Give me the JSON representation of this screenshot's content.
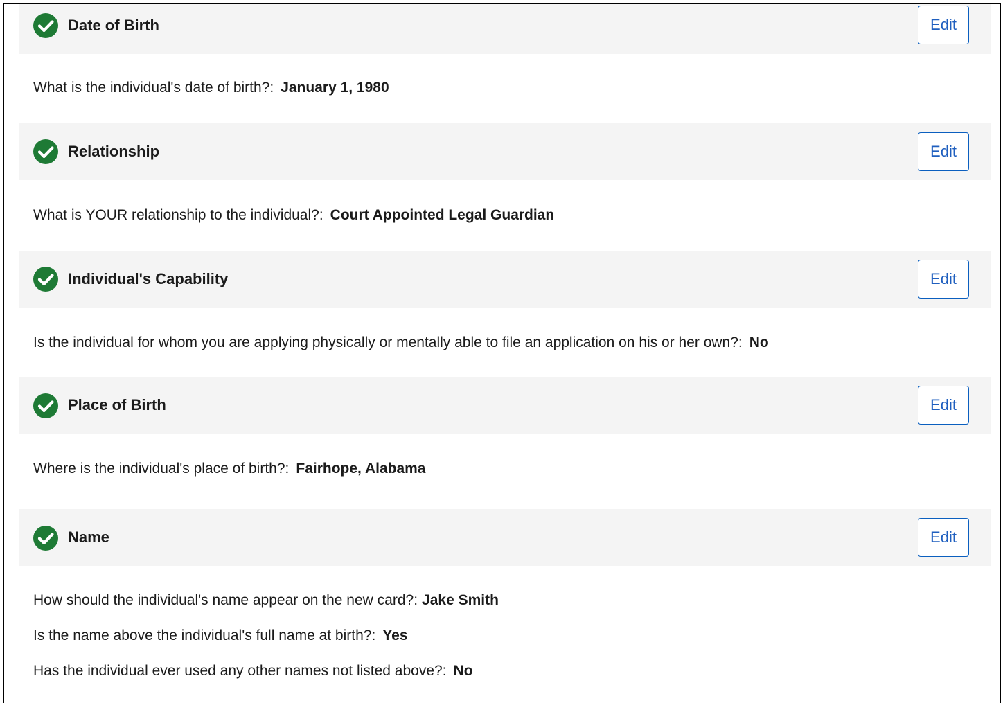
{
  "edit_label": "Edit",
  "colors": {
    "check_green": "#1e7a35",
    "edit_blue": "#1f5fbf",
    "header_bg": "#f4f4f4"
  },
  "sections": [
    {
      "title": "Date of Birth",
      "items": [
        {
          "question": "What is the individual's date of birth?:",
          "answer": "January 1, 1980"
        }
      ]
    },
    {
      "title": "Relationship",
      "items": [
        {
          "question": "What is YOUR relationship to the individual?:",
          "answer": "Court Appointed Legal Guardian"
        }
      ]
    },
    {
      "title": "Individual's Capability",
      "items": [
        {
          "question": "Is the individual for whom you are applying physically or mentally able to file an application on his or her own?:",
          "answer": "No"
        }
      ]
    },
    {
      "title": "Place of Birth",
      "items": [
        {
          "question": "Where is the individual's place of birth?:",
          "answer": "Fairhope, Alabama"
        }
      ]
    },
    {
      "title": "Name",
      "items": [
        {
          "question": "How should the individual's name appear on the new card?:",
          "answer": "Jake Smith"
        },
        {
          "question": "Is the name above the individual's full name at birth?:",
          "answer": "Yes"
        },
        {
          "question": "Has the individual ever used any other names not listed above?:",
          "answer": "No"
        }
      ]
    }
  ]
}
